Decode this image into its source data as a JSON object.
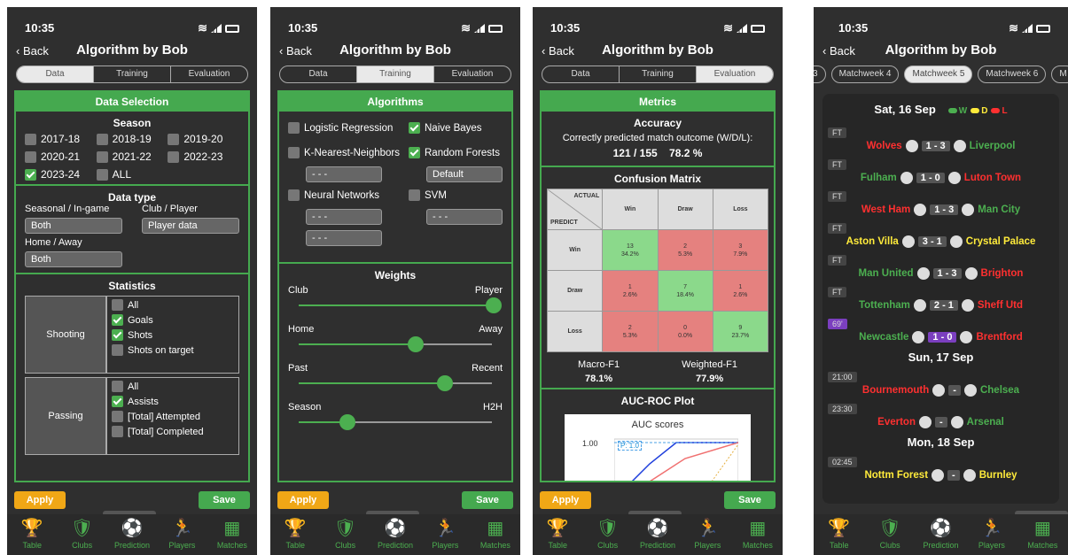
{
  "status": {
    "time": "10:35"
  },
  "nav": {
    "back": "Back",
    "title": "Algorithm by Bob"
  },
  "tabs": [
    "Data",
    "Training",
    "Evaluation"
  ],
  "buttons": {
    "apply": "Apply",
    "save": "Save"
  },
  "tabbar": [
    "Table",
    "Clubs",
    "Prediction",
    "Players",
    "Matches"
  ],
  "p1": {
    "header": "Data Selection",
    "season": {
      "title": "Season",
      "items": [
        {
          "label": "2017-18",
          "checked": false
        },
        {
          "label": "2018-19",
          "checked": false
        },
        {
          "label": "2019-20",
          "checked": false
        },
        {
          "label": "2020-21",
          "checked": false
        },
        {
          "label": "2021-22",
          "checked": false
        },
        {
          "label": "2022-23",
          "checked": false
        },
        {
          "label": "2023-24",
          "checked": true
        },
        {
          "label": "ALL",
          "checked": false
        }
      ]
    },
    "dtype": {
      "title": "Data type",
      "seasonal_label": "Seasonal / In-game",
      "seasonal_value": "Both",
      "club_label": "Club / Player",
      "club_value": "Player data",
      "home_label": "Home / Away",
      "home_value": "Both"
    },
    "stats": {
      "title": "Statistics",
      "shooting": "Shooting",
      "shooting_items": [
        {
          "label": "All",
          "checked": false
        },
        {
          "label": "Goals",
          "checked": true
        },
        {
          "label": "Shots",
          "checked": true
        },
        {
          "label": "Shots on target",
          "checked": false
        }
      ],
      "passing": "Passing",
      "passing_items": [
        {
          "label": "All",
          "checked": false
        },
        {
          "label": "Assists",
          "checked": true
        },
        {
          "label": "[Total] Attempted",
          "checked": false
        },
        {
          "label": "[Total] Completed",
          "checked": false
        }
      ]
    }
  },
  "p2": {
    "header": "Algorithms",
    "algos": {
      "lr": "Logistic Regression",
      "nb": "Naive Bayes",
      "knn": "K-Nearest-Neighbors",
      "rf": "Random Forests",
      "nn": "Neural Networks",
      "svm": "SVM",
      "dash": "- - -",
      "default": "Default"
    },
    "weights": {
      "title": "Weights",
      "rows": [
        {
          "l": "Club",
          "r": "Player",
          "v": 1.0
        },
        {
          "l": "Home",
          "r": "Away",
          "v": 0.6
        },
        {
          "l": "Past",
          "r": "Recent",
          "v": 0.75
        },
        {
          "l": "Season",
          "r": "H2H",
          "v": 0.25
        }
      ]
    }
  },
  "p3": {
    "header": "Metrics",
    "accuracy": {
      "title": "Accuracy",
      "desc": "Correctly predicted match outcome (W/D/L):",
      "count": "121 / 155",
      "pct": "78.2 %"
    },
    "cm": {
      "title": "Confusion Matrix",
      "actual": "ACTUAL",
      "predict": "PREDICT",
      "cols": [
        "Win",
        "Draw",
        "Loss"
      ],
      "rows": [
        {
          "name": "Win",
          "cells": [
            [
              "13",
              "34.2%"
            ],
            [
              "2",
              "5.3%"
            ],
            [
              "3",
              "7.9%"
            ]
          ]
        },
        {
          "name": "Draw",
          "cells": [
            [
              "1",
              "2.6%"
            ],
            [
              "7",
              "18.4%"
            ],
            [
              "1",
              "2.6%"
            ]
          ]
        },
        {
          "name": "Loss",
          "cells": [
            [
              "2",
              "5.3%"
            ],
            [
              "0",
              "0.0%"
            ],
            [
              "9",
              "23.7%"
            ]
          ]
        }
      ]
    },
    "f1": {
      "macro_label": "Macro-F1",
      "macro": "78.1%",
      "weighted_label": "Weighted-F1",
      "weighted": "77.9%"
    },
    "auc": {
      "title": "AUC-ROC Plot",
      "plot_title": "AUC scores",
      "ytick": "1.00",
      "legend": "P: 1.0"
    }
  },
  "p4": {
    "weeks": [
      "3",
      "Matchweek 4",
      "Matchweek 5",
      "Matchweek 6",
      "M"
    ],
    "days": [
      {
        "d": "Sat, 16 Sep"
      },
      {
        "d": "Sun, 17 Sep"
      },
      {
        "d": "Mon, 18 Sep"
      }
    ],
    "legend": {
      "w": "W",
      "d": "D",
      "l": "L"
    },
    "matches": [
      {
        "tag": "FT",
        "home": "Wolves",
        "score": "1 - 3",
        "away": "Liverpool",
        "hc": "red",
        "ac": "green"
      },
      {
        "tag": "FT",
        "home": "Fulham",
        "score": "1 - 0",
        "away": "Luton Town",
        "hc": "green",
        "ac": "red"
      },
      {
        "tag": "FT",
        "home": "West Ham",
        "score": "1 - 3",
        "away": "Man City",
        "hc": "red",
        "ac": "green"
      },
      {
        "tag": "FT",
        "home": "Aston Villa",
        "score": "3 - 1",
        "away": "Crystal Palace",
        "hc": "yel",
        "ac": "yel"
      },
      {
        "tag": "FT",
        "home": "Man United",
        "score": "1 - 3",
        "away": "Brighton",
        "hc": "green",
        "ac": "red"
      },
      {
        "tag": "FT",
        "home": "Tottenham",
        "score": "2 - 1",
        "away": "Sheff Utd",
        "hc": "green",
        "ac": "red"
      },
      {
        "tag": "69'",
        "home": "Newcastle",
        "score": "1 - 0",
        "away": "Brentford",
        "hc": "green",
        "ac": "red"
      },
      {
        "tag": "21:00",
        "home": "Bournemouth",
        "score": "-",
        "away": "Chelsea",
        "hc": "red",
        "ac": "green"
      },
      {
        "tag": "23:30",
        "home": "Everton",
        "score": "-",
        "away": "Arsenal",
        "hc": "red",
        "ac": "green"
      },
      {
        "tag": "02:45",
        "home": "Nottm Forest",
        "score": "-",
        "away": "Burnley",
        "hc": "yel",
        "ac": "yel"
      }
    ]
  }
}
